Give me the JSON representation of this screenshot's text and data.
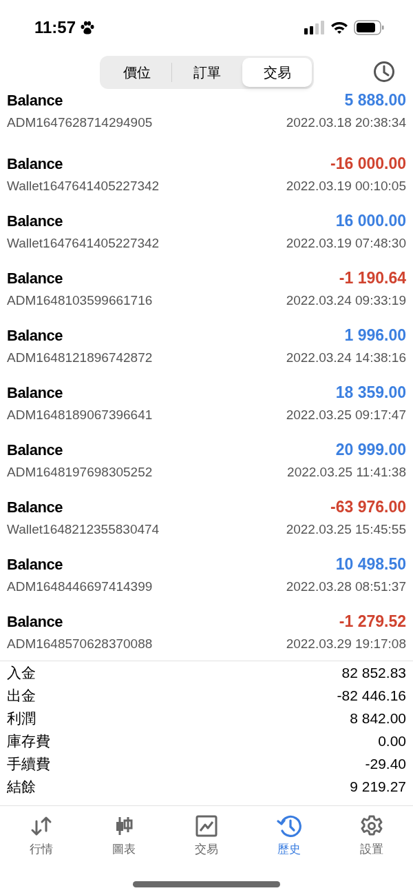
{
  "status_bar": {
    "time": "11:57"
  },
  "segments": [
    {
      "label": "價位",
      "selected": false
    },
    {
      "label": "訂單",
      "selected": false
    },
    {
      "label": "交易",
      "selected": true
    }
  ],
  "transactions": [
    {
      "title": "Balance",
      "reference": "ADM1647628714294905",
      "amount": "5 888.00",
      "time": "2022.03.18 20:38:34",
      "color": "#3b7fe0"
    },
    {
      "title": "Balance",
      "reference": "Wallet1647641405227342",
      "amount": "-16 000.00",
      "time": "2022.03.19 00:10:05",
      "color": "#d0432f"
    },
    {
      "title": "Balance",
      "reference": "Wallet1647641405227342",
      "amount": "16 000.00",
      "time": "2022.03.19 07:48:30",
      "color": "#3b7fe0"
    },
    {
      "title": "Balance",
      "reference": "ADM1648103599661716",
      "amount": "-1 190.64",
      "time": "2022.03.24 09:33:19",
      "color": "#d0432f"
    },
    {
      "title": "Balance",
      "reference": "ADM1648121896742872",
      "amount": "1 996.00",
      "time": "2022.03.24 14:38:16",
      "color": "#3b7fe0"
    },
    {
      "title": "Balance",
      "reference": "ADM1648189067396641",
      "amount": "18 359.00",
      "time": "2022.03.25 09:17:47",
      "color": "#3b7fe0"
    },
    {
      "title": "Balance",
      "reference": "ADM1648197698305252",
      "amount": "20 999.00",
      "time": "2022.03.25 11:41:38",
      "color": "#3b7fe0"
    },
    {
      "title": "Balance",
      "reference": "Wallet1648212355830474",
      "amount": "-63 976.00",
      "time": "2022.03.25 15:45:55",
      "color": "#d0432f"
    },
    {
      "title": "Balance",
      "reference": "ADM1648446697414399",
      "amount": "10 498.50",
      "time": "2022.03.28 08:51:37",
      "color": "#3b7fe0"
    },
    {
      "title": "Balance",
      "reference": "ADM1648570628370088",
      "amount": "-1 279.52",
      "time": "2022.03.29 19:17:08",
      "color": "#d0432f"
    }
  ],
  "summary": [
    {
      "label": "入金",
      "value": "82 852.83"
    },
    {
      "label": "出金",
      "value": "-82 446.16"
    },
    {
      "label": "利潤",
      "value": "8 842.00"
    },
    {
      "label": "庫存費",
      "value": "0.00"
    },
    {
      "label": "手續費",
      "value": "-29.40"
    },
    {
      "label": "結餘",
      "value": "9 219.27"
    }
  ],
  "tab_bar": [
    {
      "label": "行情",
      "kind": "quotes",
      "selected": false
    },
    {
      "label": "圖表",
      "kind": "chart",
      "selected": false
    },
    {
      "label": "交易",
      "kind": "trade",
      "selected": false
    },
    {
      "label": "歷史",
      "kind": "history",
      "selected": true
    },
    {
      "label": "設置",
      "kind": "settings",
      "selected": false
    }
  ]
}
